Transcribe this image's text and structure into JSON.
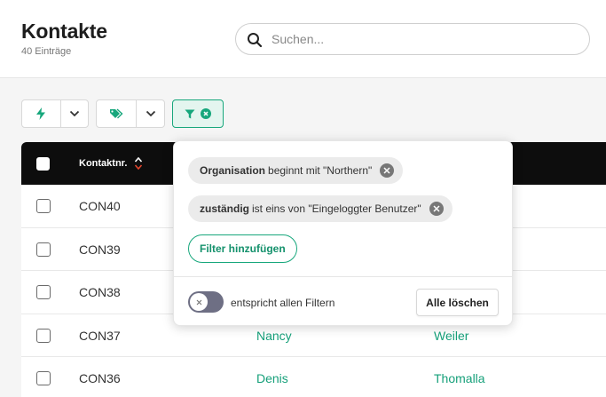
{
  "header": {
    "title": "Kontakte",
    "subtitle": "40 Einträge",
    "search_placeholder": "Suchen..."
  },
  "toolbar": {
    "actions_icon": "bolt-icon",
    "tags_icon": "tags-icon",
    "filter_icon": "filter-icon",
    "filter_active_icon": "clear-circle-icon"
  },
  "table": {
    "columns": [
      {
        "label": "Kontaktnr."
      }
    ],
    "rows": [
      {
        "id": "CON40",
        "first": "",
        "last": ""
      },
      {
        "id": "CON39",
        "first": "",
        "last": ""
      },
      {
        "id": "CON38",
        "first": "",
        "last": ""
      },
      {
        "id": "CON37",
        "first": "Nancy",
        "last": "Weiler"
      },
      {
        "id": "CON36",
        "first": "Denis",
        "last": "Thomalla"
      }
    ]
  },
  "filter_popover": {
    "filters": [
      {
        "field": "Organisation",
        "condition": "beginnt mit \"Northern\""
      },
      {
        "field": "zuständig",
        "condition": "ist eins von \"Eingeloggter Benutzer\""
      }
    ],
    "add_filter_label": "Filter hinzufügen",
    "match_all_label": "entspricht allen Filtern",
    "match_all_enabled": false,
    "clear_all_label": "Alle löschen"
  },
  "colors": {
    "accent": "#17a77c",
    "accent_bg": "#e4f5ef",
    "header_row": "#0d0d0d",
    "toggle_off": "#6e6f84",
    "sort_icon": "#e0452d"
  }
}
